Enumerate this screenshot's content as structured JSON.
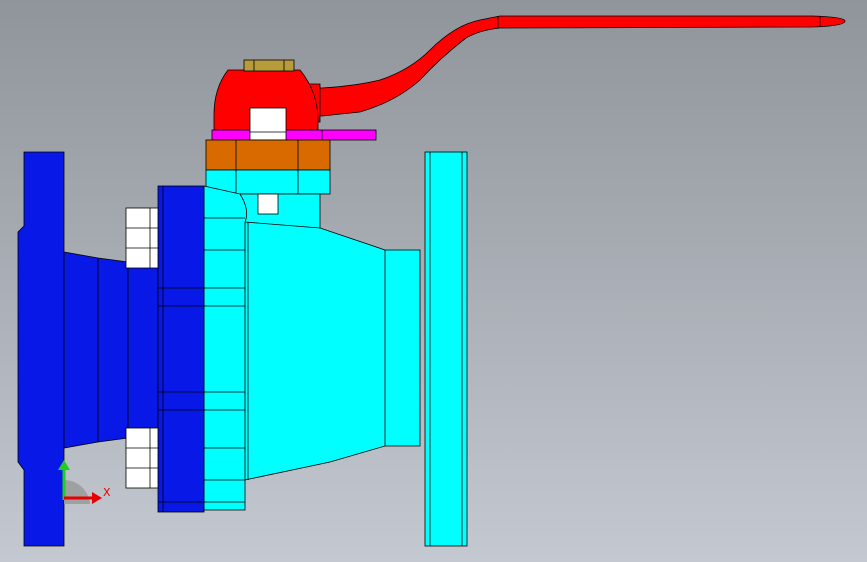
{
  "viewport": {
    "background_top": "#8f959b",
    "background_bottom": "#c4c8d0"
  },
  "colors": {
    "left_flange": "#0818e6",
    "body": "#00ffff",
    "right_flange": "#00ffff",
    "bolt": "#ffffff",
    "gland_nut": "#d96a00",
    "stop_plate": "#ff00ff",
    "handle": "#ff0000",
    "stem_top": "#b89b3a",
    "edge": "#000000"
  },
  "triad": {
    "x_label": "X",
    "y_color": "#22cc22",
    "x_color": "#e60000"
  }
}
